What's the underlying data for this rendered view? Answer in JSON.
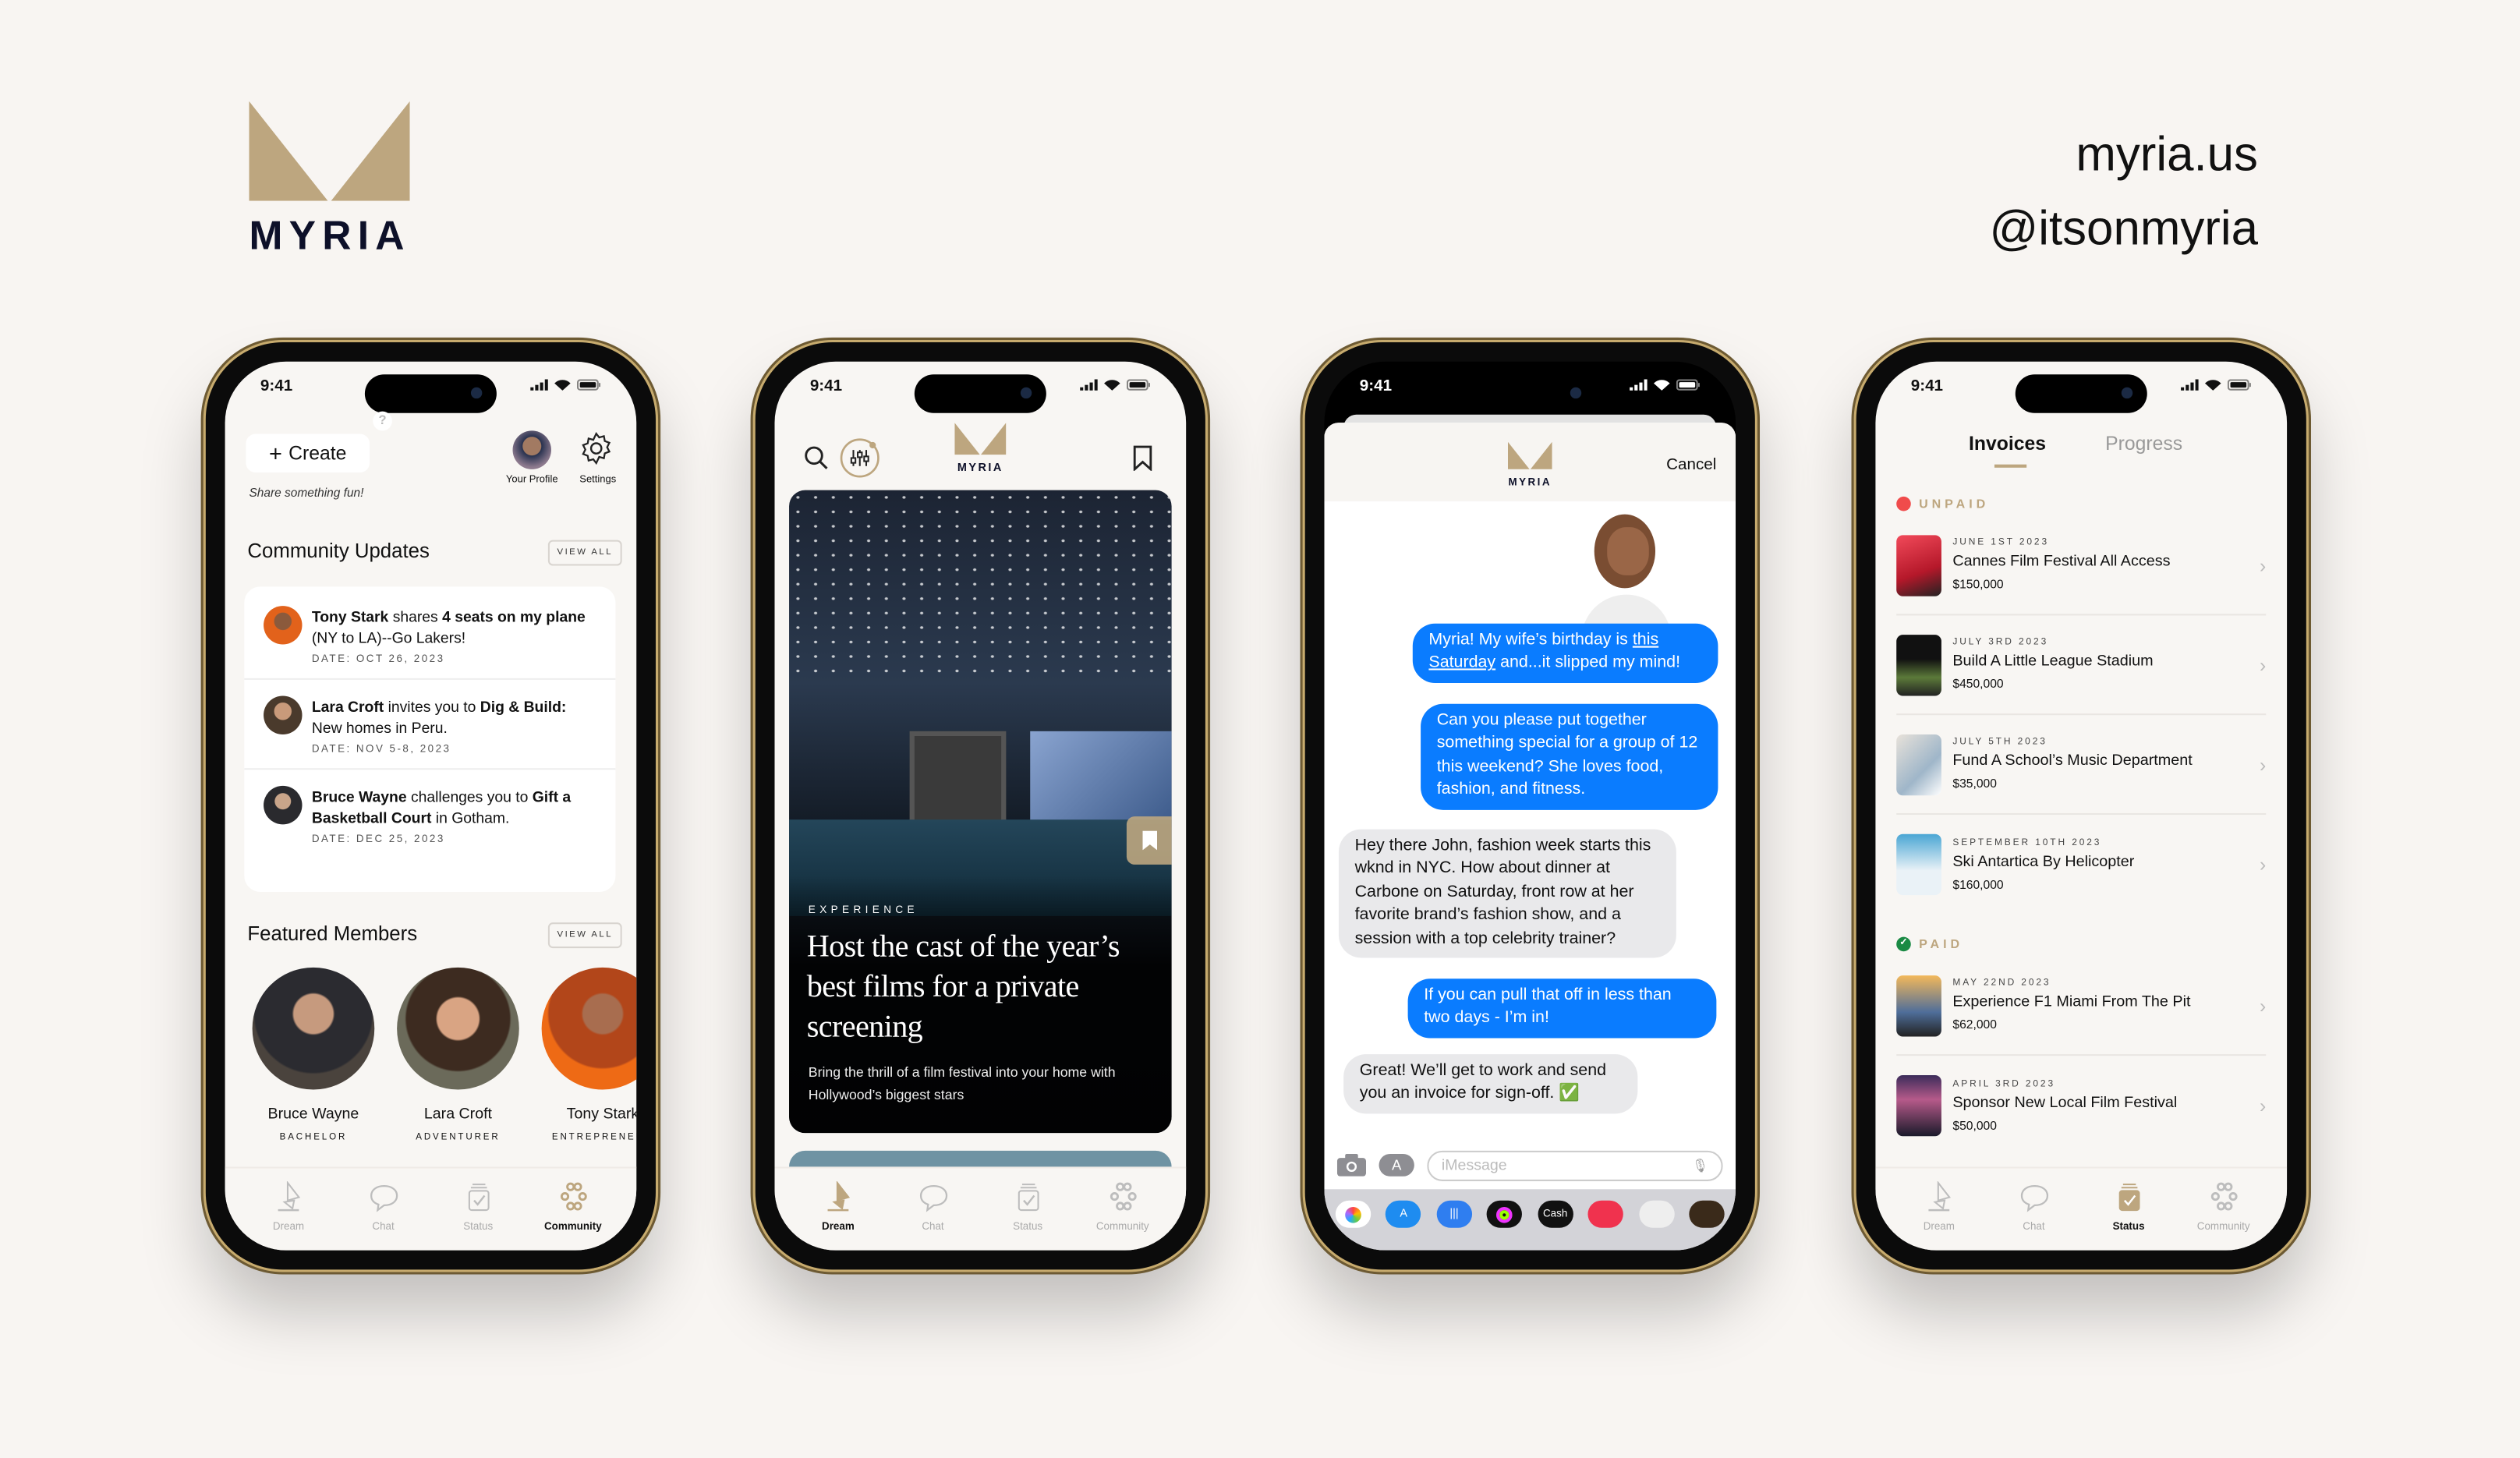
{
  "brand": {
    "name": "MYRIA",
    "website": "myria.us",
    "handle": "@itsonmyria"
  },
  "colors": {
    "accent": "#bda67f",
    "ink": "#0d1029",
    "background": "#f8f5f2",
    "imessage_blue": "#0a7cff",
    "unpaid": "#f04b4b",
    "paid": "#1a8a44"
  },
  "status_time": "9:41",
  "tabbar": [
    "Dream",
    "Chat",
    "Status",
    "Community"
  ],
  "community": {
    "create_label": "Create",
    "help": "?",
    "share_prompt": "Share something fun!",
    "profile_label": "Your Profile",
    "settings_label": "Settings",
    "updates_title": "Community Updates",
    "view_all": "VIEW ALL",
    "updates": [
      {
        "segments": [
          {
            "text": "Tony Stark",
            "bold": true
          },
          {
            "text": " shares "
          },
          {
            "text": "4 seats on my plane",
            "bold": true
          },
          {
            "text": " (NY to LA)--Go Lakers!"
          }
        ],
        "date": "DATE: OCT 26, 2023"
      },
      {
        "segments": [
          {
            "text": "Lara Croft",
            "bold": true
          },
          {
            "text": " invites you to "
          },
          {
            "text": "Dig & Build:",
            "bold": true
          },
          {
            "text": " New homes in Peru."
          }
        ],
        "date": "DATE: NOV 5-8, 2023"
      },
      {
        "segments": [
          {
            "text": "Bruce Wayne",
            "bold": true
          },
          {
            "text": " challenges you to "
          },
          {
            "text": "Gift a Basketball Court",
            "bold": true
          },
          {
            "text": " in Gotham."
          }
        ],
        "date": "DATE: DEC 25, 2023"
      }
    ],
    "featured_title": "Featured Members",
    "members": [
      {
        "name": "Bruce Wayne",
        "role": "BACHELOR"
      },
      {
        "name": "Lara Croft",
        "role": "ADVENTURER"
      },
      {
        "name": "Tony Stark",
        "role": "ENTREPRENEUR"
      }
    ],
    "active_tab": "Community"
  },
  "dream": {
    "brand": "MYRIA",
    "hero": {
      "tag": "EXPERIENCE",
      "title": "Host the cast of the year’s best films for a private screening",
      "subtitle": "Bring the thrill of a film festival into your home with Hollywood’s biggest stars"
    },
    "active_tab": "Dream"
  },
  "chat": {
    "brand": "MYRIA",
    "cancel": "Cancel",
    "messages": [
      {
        "from": "me",
        "segments": [
          {
            "text": "Myria! My wife’s birthday is "
          },
          {
            "text": "this Saturday",
            "link": true
          },
          {
            "text": " and...it slipped my mind!"
          }
        ]
      },
      {
        "from": "me",
        "segments": [
          {
            "text": "Can you please put together something special for a group of 12 this weekend? She loves food, fashion, and fitness."
          }
        ]
      },
      {
        "from": "myria",
        "segments": [
          {
            "text": "Hey there John, fashion week starts this wknd in NYC. How about dinner at Carbone on Saturday, front row at her favorite brand’s fashion show, and a session with a top celebrity trainer?"
          }
        ]
      },
      {
        "from": "me",
        "segments": [
          {
            "text": "If you can pull that off in less than two days - I’m in!"
          }
        ]
      },
      {
        "from": "myria",
        "segments": [
          {
            "text": "Great! We’ll get to work and send you an invoice for sign-off. ✅"
          }
        ]
      }
    ],
    "input_placeholder": "iMessage",
    "apps": [
      "photos-icon",
      "app-store-icon",
      "audio-message-icon",
      "fitness-icon",
      "apple-cash-icon",
      "image-search-icon",
      "memoji-stickers-icon",
      "memoji-icon"
    ],
    "apple_cash_label": "Cash"
  },
  "status": {
    "tabs": [
      "Invoices",
      "Progress"
    ],
    "active": "Invoices",
    "sections": [
      {
        "label": "UNPAID",
        "items": [
          {
            "date": "JUNE 1ST 2023",
            "title": "Cannes Film Festival All Access",
            "amount": "$150,000"
          },
          {
            "date": "JULY 3RD 2023",
            "title": "Build A Little League Stadium",
            "amount": "$450,000"
          },
          {
            "date": "JULY 5TH 2023",
            "title": "Fund A School’s Music Department",
            "amount": "$35,000"
          },
          {
            "date": "SEPTEMBER 10TH 2023",
            "title": "Ski Antartica By Helicopter",
            "amount": "$160,000"
          }
        ]
      },
      {
        "label": "PAID",
        "items": [
          {
            "date": "MAY 22ND 2023",
            "title": "Experience F1 Miami From The Pit",
            "amount": "$62,000"
          },
          {
            "date": "APRIL 3RD 2023",
            "title": "Sponsor New Local Film Festival",
            "amount": "$50,000"
          }
        ]
      }
    ],
    "active_tab": "Status"
  }
}
